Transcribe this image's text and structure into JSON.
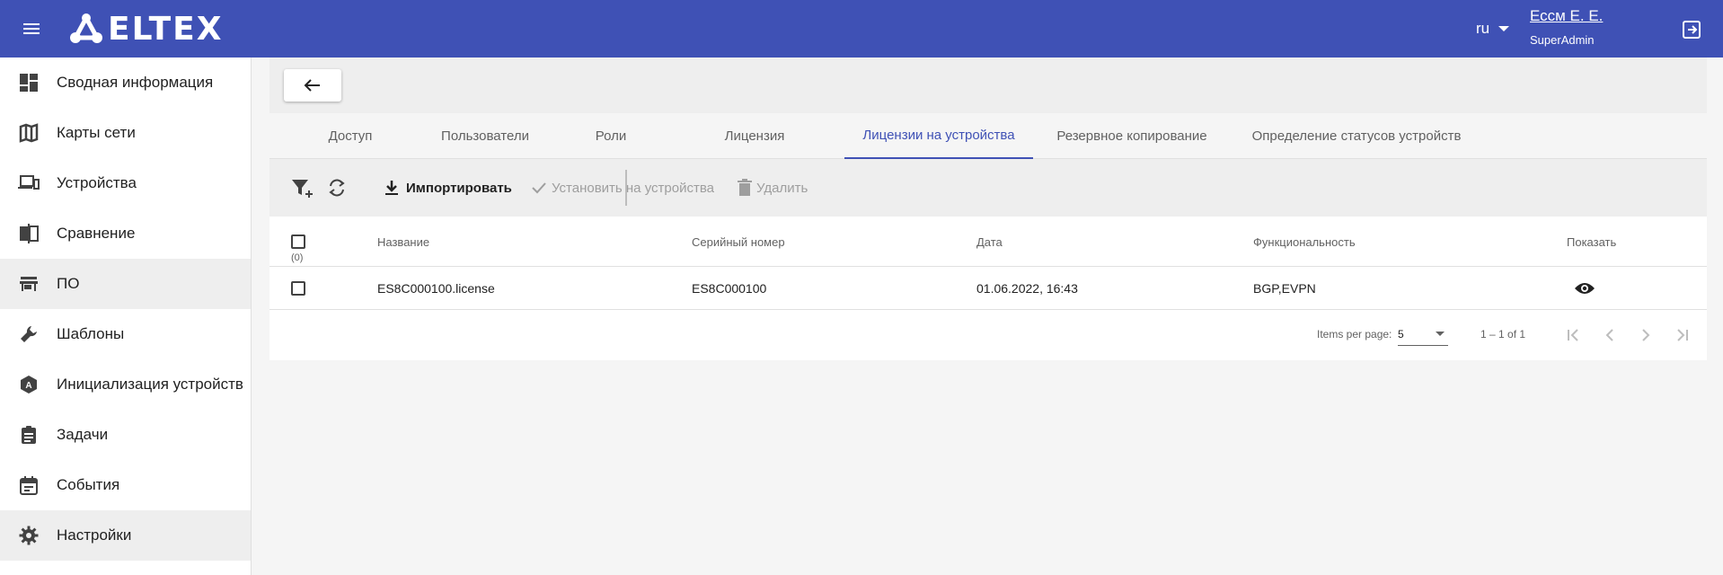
{
  "header": {
    "logo_text": "ELTEX",
    "language": "ru",
    "user_name": "Ессм Е. Е.",
    "user_role": "SuperAdmin"
  },
  "sidebar": {
    "items": [
      {
        "label": "Сводная информация",
        "icon": "dashboard-icon"
      },
      {
        "label": "Карты сети",
        "icon": "map-icon"
      },
      {
        "label": "Устройства",
        "icon": "devices-icon"
      },
      {
        "label": "Сравнение",
        "icon": "compare-icon"
      },
      {
        "label": "ПО",
        "icon": "store-icon"
      },
      {
        "label": "Шаблоны",
        "icon": "wrench-icon"
      },
      {
        "label": "Инициализация устройств",
        "icon": "adb-icon"
      },
      {
        "label": "Задачи",
        "icon": "assignment-icon"
      },
      {
        "label": "События",
        "icon": "event-icon"
      },
      {
        "label": "Настройки",
        "icon": "gear-icon"
      }
    ]
  },
  "tabs": [
    "Доступ",
    "Пользователи",
    "Роли",
    "Лицензия",
    "Лицензии на устройства",
    "Резервное копирование",
    "Определение статусов устройств"
  ],
  "active_tab": "Лицензии на устройства",
  "toolbar": {
    "import_label": "Импортировать",
    "install_label": "Установить на устройства",
    "delete_label": "Удалить"
  },
  "table": {
    "selected_count": "(0)",
    "columns": [
      "Название",
      "Серийный номер",
      "Дата",
      "Функциональность",
      "Показать"
    ],
    "rows": [
      {
        "name": "ES8C000100.license",
        "serial": "ES8C000100",
        "date": "01.06.2022, 16:43",
        "functionality": "BGP,EVPN"
      }
    ]
  },
  "paginator": {
    "items_per_page_label": "Items per page:",
    "items_per_page_value": "5",
    "range_label": "1 – 1 of 1"
  },
  "colors": {
    "header_bg": "#3f51b5",
    "accent": "#3f51b5"
  }
}
